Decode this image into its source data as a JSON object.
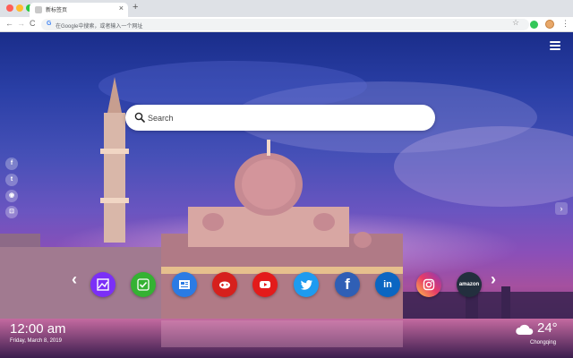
{
  "browser": {
    "tab_title": "新标签页",
    "tab_close": "×",
    "new_tab": "+",
    "nav_back": "←",
    "nav_forward": "→",
    "nav_reload": "C",
    "omnibox_logo": "G",
    "omnibox_placeholder": "在Google中搜索，或者输入一个网址",
    "bookmark_star": "☆",
    "menu": "⋮"
  },
  "page": {
    "search": {
      "placeholder": "Search"
    },
    "social_sidebar": [
      {
        "label": "f",
        "icon": "facebook-icon"
      },
      {
        "label": "t",
        "icon": "twitter-icon"
      },
      {
        "label": "◉",
        "icon": "location-icon"
      },
      {
        "label": "⊡",
        "icon": "share-icon"
      }
    ],
    "side_next": "›",
    "dock": {
      "prev": "‹",
      "next": "›",
      "apps": [
        {
          "name": "photos-app",
          "label": "",
          "color": "#7b2ff7",
          "icon": "image-icon"
        },
        {
          "name": "tasks-app",
          "label": "",
          "color": "#34b233",
          "icon": "check-icon"
        },
        {
          "name": "news-app",
          "label": "",
          "color": "#2b7be4",
          "icon": "news-icon"
        },
        {
          "name": "games-app",
          "label": "",
          "color": "#d6201d",
          "icon": "gamepad-icon"
        },
        {
          "name": "youtube-app",
          "label": "",
          "color": "#e31b1b",
          "icon": "play-icon"
        },
        {
          "name": "twitter-app",
          "label": "",
          "color": "#1d9bf0",
          "icon": "twitter-bird-icon"
        },
        {
          "name": "facebook-app",
          "label": "f",
          "color": "#2f5fb5",
          "icon": "facebook-icon"
        },
        {
          "name": "linkedin-app",
          "label": "in",
          "color": "#0b66c2",
          "icon": "linkedin-icon"
        },
        {
          "name": "instagram-app",
          "label": "",
          "color": "#d6249f",
          "icon": "instagram-icon"
        },
        {
          "name": "amazon-app",
          "label": "amazon",
          "color": "#232f3e",
          "icon": "amazon-icon"
        }
      ]
    },
    "clock": {
      "time": "12:00 am",
      "date": "Friday, March 8, 2019"
    },
    "weather": {
      "temperature": "24°",
      "city": "Chongqing",
      "icon": "cloud-icon"
    }
  }
}
